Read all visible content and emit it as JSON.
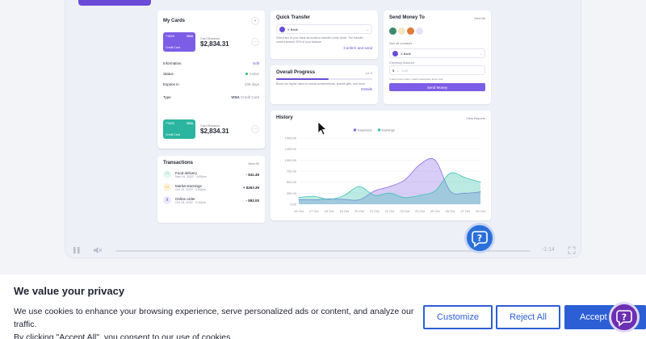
{
  "dashboard": {
    "my_cards": {
      "title": "My Cards",
      "add_label": "+",
      "card1": {
        "number": "**4528",
        "brand": "VISA",
        "label": "Credit Card",
        "balance_label": "Card Balance",
        "balance": "$2,834.31",
        "color": "#7c5de6"
      },
      "card2": {
        "number": "**4528",
        "brand": "VISA",
        "label": "Credit Card",
        "balance_label": "Card Balance",
        "balance": "$2,834.31",
        "color": "#2bb5a0"
      },
      "kebab": "···",
      "info": {
        "title": "Information",
        "edit": "Edit",
        "status_label": "Status",
        "status_value": "Active",
        "expires_label": "Expires in",
        "expires_value": "135 days",
        "type_label": "Type",
        "type_brand": "VISA",
        "type_value": "Credit Card"
      }
    },
    "quick_transfer": {
      "title": "Quick Transfer",
      "bank": "X Bank",
      "desc": "Select two of your bank accounts to transfer some funds. The transfer carried amount 20% of your balance.",
      "confirm": "Confirm and send"
    },
    "overall_progress": {
      "title": "Overall Progress",
      "count": "Lv. 1",
      "desc": "Boost our higher users to unlock achievements, special gifts, and more.",
      "details": "Details",
      "progress": 0.55
    },
    "send_money": {
      "title": "Send Money To",
      "view_all": "View All",
      "see_all": "See all contacts",
      "bank": "X Bank",
      "currency_label": "Currency",
      "amount_label": "Amount",
      "currency": "$",
      "amount_placeholder": "0.00",
      "note": "*Lorem ipsum dolor, mauris destination items note",
      "button": "Send Money"
    },
    "transactions": {
      "title": "Transactions",
      "view_all": "View All",
      "items": [
        {
          "name": "Food delivery",
          "date": "Nov 24, 2022 · 4:00pm",
          "amount": "- $41.49",
          "icon": "wifi-icon",
          "icon_color": "#22b07d",
          "bg": "#e4f7ee"
        },
        {
          "name": "Market Earnings",
          "date": "Oct 15, 2022 · 2:00pm",
          "amount": "+ $263.39",
          "icon": "wallet-icon",
          "icon_color": "#f59e0b",
          "bg": "#fdf2dc"
        },
        {
          "name": "Online order",
          "date": "Oct 15, 2022 · 2:15pm",
          "amount": "- $92.00",
          "icon": "cart-icon",
          "icon_color": "#6a4bd8",
          "bg": "#ece8fb"
        }
      ]
    },
    "history": {
      "title": "History",
      "view_reports": "View Reports"
    }
  },
  "chart_data": {
    "type": "area",
    "title": "History",
    "x": [
      "16 Oct",
      "17 Oct",
      "18 Oct",
      "19 Oct",
      "20 Oct",
      "21 Oct",
      "22 Oct",
      "23 Oct",
      "24 Oct",
      "25 Oct",
      "26 Oct",
      "27 Oct",
      "28 Oct"
    ],
    "series": [
      {
        "name": "Expenses",
        "color": "#8b6fe6",
        "values": [
          100,
          100,
          120,
          110,
          100,
          300,
          400,
          550,
          900,
          1000,
          300,
          250,
          280
        ]
      },
      {
        "name": "Earnings",
        "color": "#3cc4b0",
        "values": [
          150,
          180,
          110,
          200,
          400,
          200,
          250,
          150,
          200,
          300,
          700,
          600,
          500
        ]
      }
    ],
    "y_ticks": [
      "1500.00",
      "1250.00",
      "1000.00",
      "750.00",
      "500.00",
      "250.00",
      "0.00"
    ],
    "ylim": [
      0,
      1500
    ],
    "grid": true,
    "legend": "top-center"
  },
  "player": {
    "time": "-1:14"
  },
  "cookie": {
    "title": "We value your privacy",
    "line1": "We use cookies to enhance your browsing experience, serve personalized ads or content, and analyze our traffic.",
    "line2": "By clicking \"Accept All\", you consent to our use of cookies.",
    "customize": "Customize",
    "reject": "Reject All",
    "accept": "Accept All"
  },
  "colors": {
    "accent": "#6a4bd8",
    "teal": "#2bb5a0",
    "cookie_blue": "#2c5fd6",
    "help_blue": "#2b6fd9"
  }
}
